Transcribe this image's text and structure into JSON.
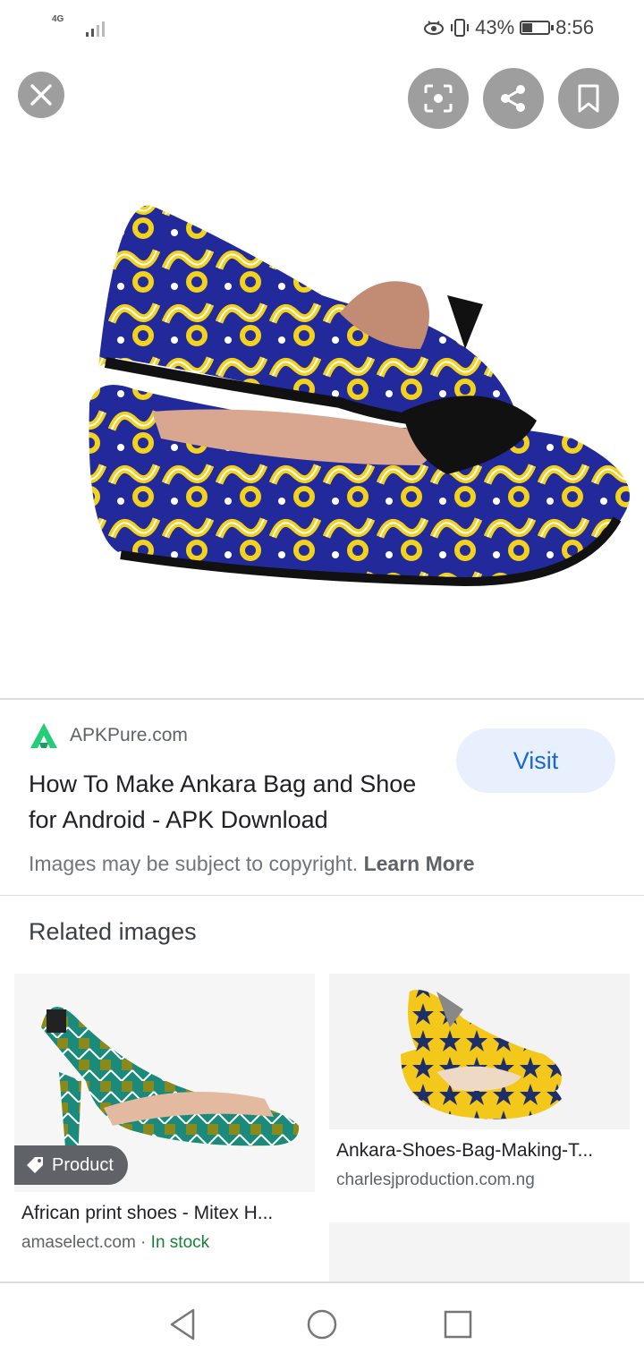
{
  "status_bar": {
    "network": "4G",
    "battery": "43%",
    "battery_level": 0.43,
    "time": "8:56"
  },
  "toolbar": {
    "close_icon": "close-icon",
    "lens_icon": "lens-icon",
    "share_icon": "share-icon",
    "bookmark_icon": "bookmark-icon"
  },
  "result": {
    "source": "APKPure.com",
    "title": "How To Make Ankara Bag and Shoe for Android - APK Download",
    "visit_label": "Visit",
    "copyright_text": "Images may be subject to copyright.",
    "learn_more": "Learn More"
  },
  "related": {
    "heading": "Related images",
    "items": [
      {
        "badge": "Product",
        "title": "African print shoes - Mitex H...",
        "source": "amaselect.com",
        "separator": " · ",
        "stock": "In stock"
      },
      {
        "title": "Ankara-Shoes-Bag-Making-T...",
        "source": "charlesjproduction.com.ng"
      }
    ]
  },
  "colors": {
    "accent": "#1967d2",
    "visit_bg": "#e8f0fe",
    "in_stock": "#188038",
    "overlay_button": "#9e9e9e"
  }
}
